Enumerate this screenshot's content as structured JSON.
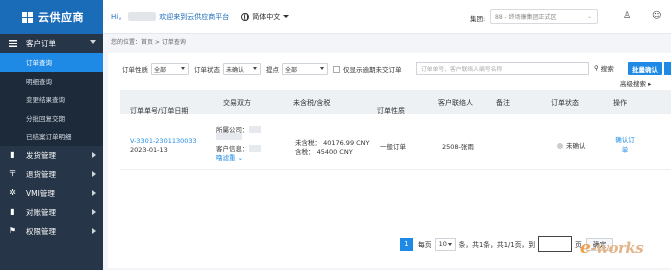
{
  "app": {
    "logo_text": "云供应商",
    "colors": {
      "sidebar": "#263548",
      "logo_bar": "#1a6bb8",
      "accent": "#1e8ae6"
    }
  },
  "header": {
    "greeting": "Hi，",
    "welcome": "欢迎来到云供应商平台",
    "language": "简体中文",
    "group_label": "集团:",
    "group_value": "88 - 终场廉集团正式区",
    "icons": [
      "globe-icon",
      "user-icon",
      "chat-icon"
    ]
  },
  "sidebar": {
    "groups": [
      {
        "label": "客户订单",
        "icon": "menu-icon",
        "expanded": true,
        "items": [
          {
            "label": "订单查询",
            "active": true
          },
          {
            "label": "明细查询",
            "active": false
          },
          {
            "label": "变更结果查询",
            "active": false
          },
          {
            "label": "分批回复交期",
            "active": false
          },
          {
            "label": "已结案订单明细",
            "active": false
          }
        ]
      },
      {
        "label": "发货管理",
        "icon": "file-icon"
      },
      {
        "label": "退货管理",
        "icon": "return-icon"
      },
      {
        "label": "VMI管理",
        "icon": "cog-icon"
      },
      {
        "label": "对账管理",
        "icon": "file-icon"
      },
      {
        "label": "权限管理",
        "icon": "flag-icon"
      }
    ]
  },
  "breadcrumb": "您的位置：首页 > 订单查询",
  "filters": {
    "order_type_label": "订单性质",
    "order_type_value": "全部",
    "order_status_label": "订单状态",
    "order_status_value": "未确认",
    "delivery_label": "提点",
    "delivery_value": "全部",
    "overdue_label": "仅显示逾期未交订单",
    "search_placeholder": "订单单号、客户联络人编号名称",
    "search_label": "搜索",
    "batch_confirm_label": "批量确认",
    "advanced_search_label": "高级搜索"
  },
  "table": {
    "columns": [
      "订单单号/订单日期",
      "交易双方",
      "未含税/含税",
      "订单性质",
      "客户联络人",
      "备注",
      "订单状态",
      "操作"
    ],
    "rows": [
      {
        "order_no": "V-3301-2301130033",
        "order_date": "2023-01-13",
        "buyer_label": "所屬公司：",
        "customer_label": "客户信息：",
        "see_more": "噜滤重",
        "untaxed": "未含税：  40176.99 CNY",
        "taxed": "含税：  45400 CNY",
        "order_type": "一般订单",
        "contact": "2508-张雨",
        "note": "",
        "status": "未确认",
        "action": "确认订单"
      }
    ]
  },
  "pagination": {
    "current_page": "1",
    "per_page_label": "每页",
    "page_size": "10",
    "summary": "条，共1条，共1/1页，到",
    "page_unit": "页",
    "confirm_label": "确定"
  },
  "watermark": {
    "prefix": "e",
    "rest": "-works"
  }
}
